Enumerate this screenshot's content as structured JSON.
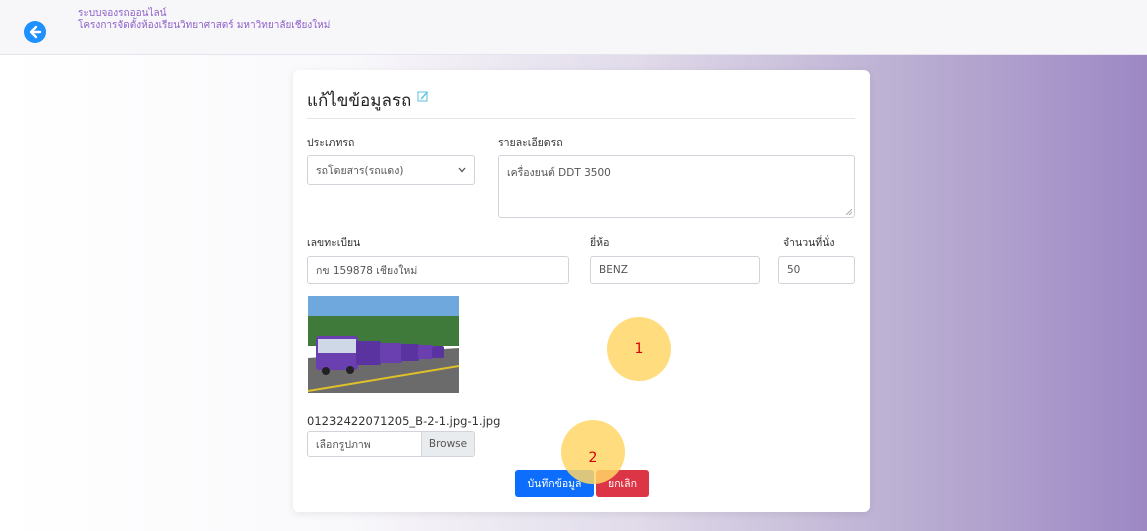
{
  "header": {
    "line1": "ระบบจองรถออนไลน์",
    "line2": "โครงการจัดตั้งห้องเรียนวิทยาศาสตร์ มหาวิทยาลัยเชียงใหม่",
    "back_icon": "arrow-left-circle-icon"
  },
  "form": {
    "title": "แก้ไขข้อมูลรถ",
    "title_icon": "edit-icon",
    "type_label": "ประเภทรถ",
    "type_value": "รถโดยสาร(รถแดง)",
    "detail_label": "รายละเอียดรถ",
    "detail_value": "เครื่องยนต์ DDT 3500",
    "plate_label": "เลขทะเบียน",
    "plate_value": "กข 159878 เชียงใหม่",
    "brand_label": "ยี่ห้อ",
    "brand_value": "BENZ",
    "seats_label": "จำนวนที่นั่ง",
    "seats_value": "50",
    "file_name": "01232422071205_B-2-1.jpg-1.jpg",
    "file_placeholder": "เลือกรูปภาพ",
    "browse_label": "Browse",
    "save_label": "บันทึกข้อมูล",
    "cancel_label": "ยกเลิก"
  },
  "markers": {
    "m1": "1",
    "m2": "2"
  },
  "colors": {
    "primary": "#0d6efd",
    "danger": "#dc3545",
    "brand_text": "#8e5fc9",
    "marker": "#ffd666"
  }
}
